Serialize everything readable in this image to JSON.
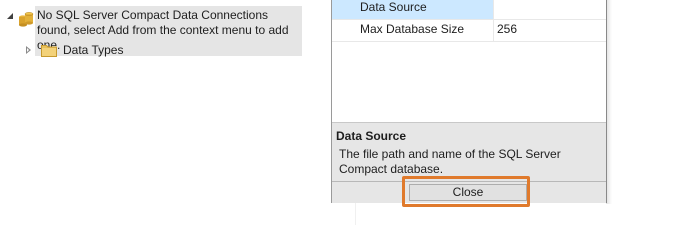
{
  "explorer": {
    "root_label": "No SQL Server Compact Data Connections found, select Add from the context menu to add one.",
    "root_icon": "database-connections-icon",
    "child_label": "Data Types",
    "child_icon": "folder-icon"
  },
  "properties": {
    "rows": [
      {
        "name": "Data Source",
        "value": ""
      },
      {
        "name": "Max Database Size",
        "value": "256"
      }
    ],
    "selected": "Data Source"
  },
  "description": {
    "title": "Data Source",
    "text": "The file path and name of the SQL Server Compact database."
  },
  "footer": {
    "close_label": "Close"
  },
  "colors": {
    "highlight": "#e07a2c",
    "selection": "#cce8ff",
    "panel": "#e6e6e6",
    "folder": "#e8c05a"
  }
}
